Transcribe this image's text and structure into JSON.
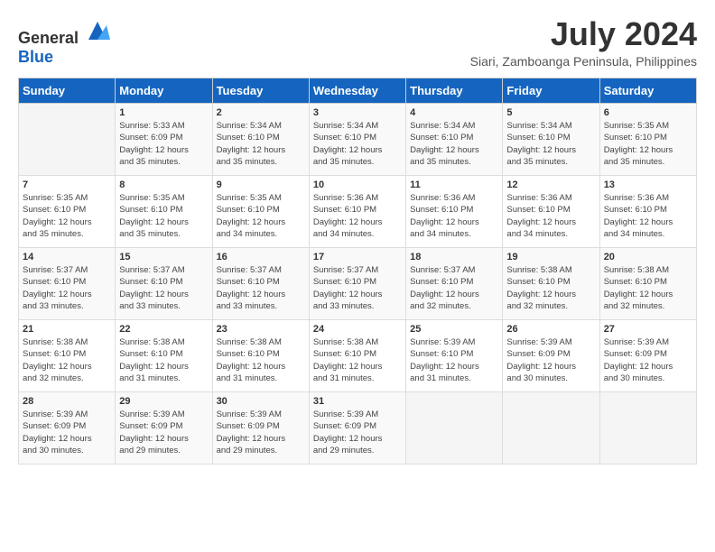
{
  "header": {
    "logo": {
      "general": "General",
      "blue": "Blue"
    },
    "title": "July 2024",
    "location": "Siari, Zamboanga Peninsula, Philippines"
  },
  "calendar": {
    "days_of_week": [
      "Sunday",
      "Monday",
      "Tuesday",
      "Wednesday",
      "Thursday",
      "Friday",
      "Saturday"
    ],
    "weeks": [
      [
        {
          "day": "",
          "info": ""
        },
        {
          "day": "1",
          "info": "Sunrise: 5:33 AM\nSunset: 6:09 PM\nDaylight: 12 hours\nand 35 minutes."
        },
        {
          "day": "2",
          "info": "Sunrise: 5:34 AM\nSunset: 6:10 PM\nDaylight: 12 hours\nand 35 minutes."
        },
        {
          "day": "3",
          "info": "Sunrise: 5:34 AM\nSunset: 6:10 PM\nDaylight: 12 hours\nand 35 minutes."
        },
        {
          "day": "4",
          "info": "Sunrise: 5:34 AM\nSunset: 6:10 PM\nDaylight: 12 hours\nand 35 minutes."
        },
        {
          "day": "5",
          "info": "Sunrise: 5:34 AM\nSunset: 6:10 PM\nDaylight: 12 hours\nand 35 minutes."
        },
        {
          "day": "6",
          "info": "Sunrise: 5:35 AM\nSunset: 6:10 PM\nDaylight: 12 hours\nand 35 minutes."
        }
      ],
      [
        {
          "day": "7",
          "info": "Sunrise: 5:35 AM\nSunset: 6:10 PM\nDaylight: 12 hours\nand 35 minutes."
        },
        {
          "day": "8",
          "info": "Sunrise: 5:35 AM\nSunset: 6:10 PM\nDaylight: 12 hours\nand 35 minutes."
        },
        {
          "day": "9",
          "info": "Sunrise: 5:35 AM\nSunset: 6:10 PM\nDaylight: 12 hours\nand 34 minutes."
        },
        {
          "day": "10",
          "info": "Sunrise: 5:36 AM\nSunset: 6:10 PM\nDaylight: 12 hours\nand 34 minutes."
        },
        {
          "day": "11",
          "info": "Sunrise: 5:36 AM\nSunset: 6:10 PM\nDaylight: 12 hours\nand 34 minutes."
        },
        {
          "day": "12",
          "info": "Sunrise: 5:36 AM\nSunset: 6:10 PM\nDaylight: 12 hours\nand 34 minutes."
        },
        {
          "day": "13",
          "info": "Sunrise: 5:36 AM\nSunset: 6:10 PM\nDaylight: 12 hours\nand 34 minutes."
        }
      ],
      [
        {
          "day": "14",
          "info": "Sunrise: 5:37 AM\nSunset: 6:10 PM\nDaylight: 12 hours\nand 33 minutes."
        },
        {
          "day": "15",
          "info": "Sunrise: 5:37 AM\nSunset: 6:10 PM\nDaylight: 12 hours\nand 33 minutes."
        },
        {
          "day": "16",
          "info": "Sunrise: 5:37 AM\nSunset: 6:10 PM\nDaylight: 12 hours\nand 33 minutes."
        },
        {
          "day": "17",
          "info": "Sunrise: 5:37 AM\nSunset: 6:10 PM\nDaylight: 12 hours\nand 33 minutes."
        },
        {
          "day": "18",
          "info": "Sunrise: 5:37 AM\nSunset: 6:10 PM\nDaylight: 12 hours\nand 32 minutes."
        },
        {
          "day": "19",
          "info": "Sunrise: 5:38 AM\nSunset: 6:10 PM\nDaylight: 12 hours\nand 32 minutes."
        },
        {
          "day": "20",
          "info": "Sunrise: 5:38 AM\nSunset: 6:10 PM\nDaylight: 12 hours\nand 32 minutes."
        }
      ],
      [
        {
          "day": "21",
          "info": "Sunrise: 5:38 AM\nSunset: 6:10 PM\nDaylight: 12 hours\nand 32 minutes."
        },
        {
          "day": "22",
          "info": "Sunrise: 5:38 AM\nSunset: 6:10 PM\nDaylight: 12 hours\nand 31 minutes."
        },
        {
          "day": "23",
          "info": "Sunrise: 5:38 AM\nSunset: 6:10 PM\nDaylight: 12 hours\nand 31 minutes."
        },
        {
          "day": "24",
          "info": "Sunrise: 5:38 AM\nSunset: 6:10 PM\nDaylight: 12 hours\nand 31 minutes."
        },
        {
          "day": "25",
          "info": "Sunrise: 5:39 AM\nSunset: 6:10 PM\nDaylight: 12 hours\nand 31 minutes."
        },
        {
          "day": "26",
          "info": "Sunrise: 5:39 AM\nSunset: 6:09 PM\nDaylight: 12 hours\nand 30 minutes."
        },
        {
          "day": "27",
          "info": "Sunrise: 5:39 AM\nSunset: 6:09 PM\nDaylight: 12 hours\nand 30 minutes."
        }
      ],
      [
        {
          "day": "28",
          "info": "Sunrise: 5:39 AM\nSunset: 6:09 PM\nDaylight: 12 hours\nand 30 minutes."
        },
        {
          "day": "29",
          "info": "Sunrise: 5:39 AM\nSunset: 6:09 PM\nDaylight: 12 hours\nand 29 minutes."
        },
        {
          "day": "30",
          "info": "Sunrise: 5:39 AM\nSunset: 6:09 PM\nDaylight: 12 hours\nand 29 minutes."
        },
        {
          "day": "31",
          "info": "Sunrise: 5:39 AM\nSunset: 6:09 PM\nDaylight: 12 hours\nand 29 minutes."
        },
        {
          "day": "",
          "info": ""
        },
        {
          "day": "",
          "info": ""
        },
        {
          "day": "",
          "info": ""
        }
      ]
    ]
  }
}
